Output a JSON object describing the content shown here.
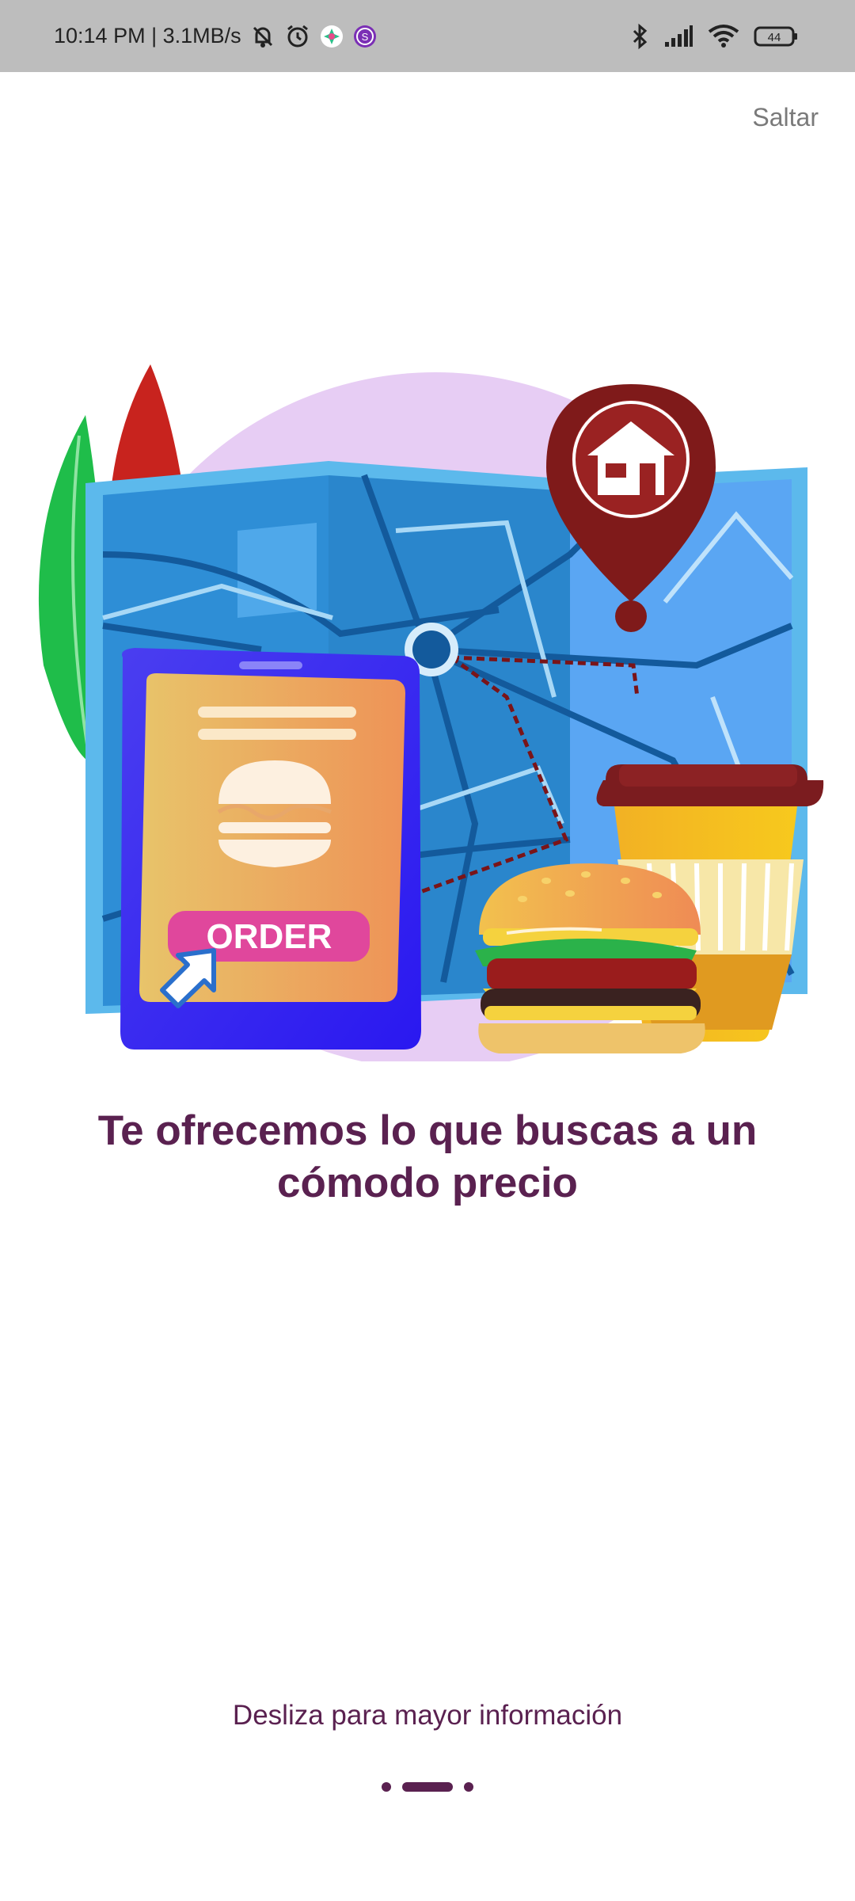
{
  "status_bar": {
    "time_speed": "10:14 PM | 3.1MB/s",
    "battery": "44",
    "icons": [
      "mute-bell-icon",
      "alarm-icon",
      "app-notification-icon",
      "app-s-icon",
      "bluetooth-icon",
      "signal-icon",
      "wifi-icon",
      "battery-icon"
    ]
  },
  "onboarding": {
    "skip_label": "Saltar",
    "illustration_button": "ORDER",
    "headline": "Te ofrecemos lo que buscas a un cómodo precio",
    "swipe_hint": "Desliza para mayor información",
    "pager": {
      "count": 3,
      "active_index": 1
    }
  },
  "colors": {
    "accent": "#5a2150",
    "status_bar_bg": "#bdbdbd"
  }
}
